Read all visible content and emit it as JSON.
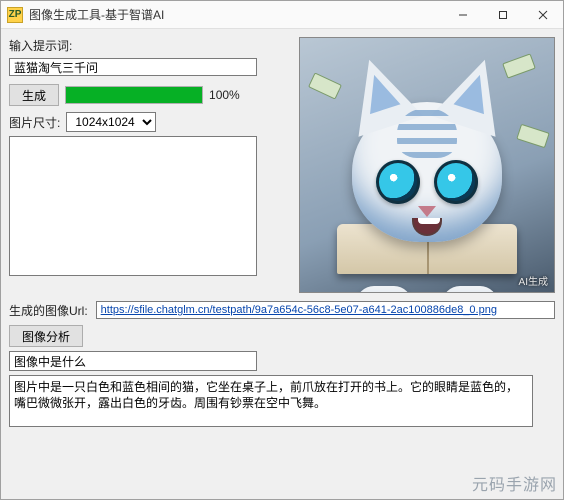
{
  "window": {
    "icon_text": "ZP",
    "title": "图像生成工具-基于智谱AI"
  },
  "prompt": {
    "label": "输入提示词:",
    "value": "蓝猫淘气三千问"
  },
  "actions": {
    "generate_label": "生成"
  },
  "progress": {
    "percent": 100,
    "percent_label": "100%"
  },
  "size": {
    "label": "图片尺寸:",
    "selected": "1024x1024"
  },
  "image": {
    "watermark": "AI生成"
  },
  "url": {
    "label": "生成的图像Url:",
    "value": "https://sfile.chatglm.cn/testpath/9a7a654c-56c8-5e07-a641-2ac100886de8_0.png"
  },
  "analysis": {
    "button_label": "图像分析",
    "question_value": "图像中是什么",
    "answer_value": "图片中是一只白色和蓝色相间的猫，它坐在桌子上，前爪放在打开的书上。它的眼睛是蓝色的，嘴巴微微张开，露出白色的牙齿。周围有钞票在空中飞舞。"
  },
  "site_watermark": "元码手游网"
}
